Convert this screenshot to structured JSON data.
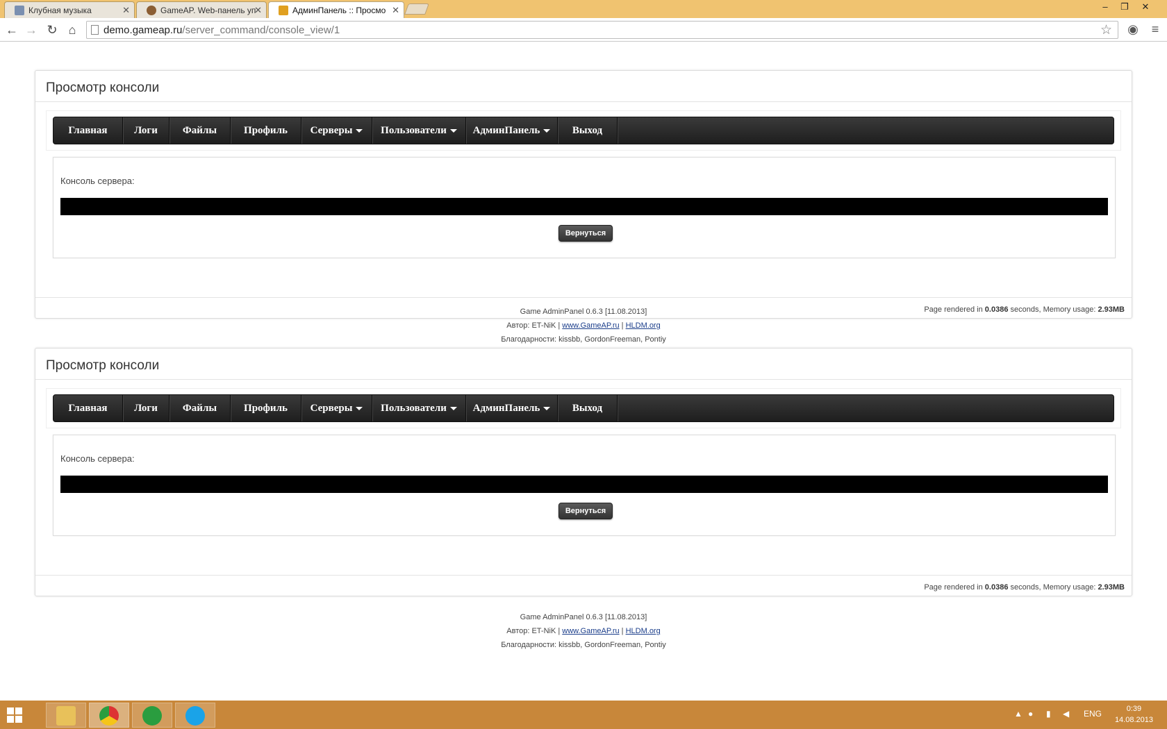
{
  "browser": {
    "tabs": [
      {
        "title": "Клубная музыка",
        "active": false
      },
      {
        "title": "GameAP. Web-панель уп",
        "active": false
      },
      {
        "title": "АдминПанель :: Просмо",
        "active": true
      }
    ],
    "url_host": "demo.gameap.ru",
    "url_path": "/server_command/console_view/1"
  },
  "page": {
    "sections": [
      {
        "title": "Просмотр консоли",
        "menu": [
          "Главная",
          "Логи",
          "Файлы",
          "Профиль",
          "Серверы",
          "Пользователи",
          "АдминПанель",
          "Выход"
        ],
        "console_label": "Консоль сервера:",
        "back_button": "Вернуться",
        "render_prefix": "Page rendered in ",
        "render_seconds": "0.0386",
        "render_mid": " seconds, Memory usage: ",
        "render_memory": "2.93MB",
        "footer_version": "Game AdminPanel 0.6.3 [11.08.2013]",
        "footer_author_prefix": "Автор: ET-NiK | ",
        "footer_link1": "www.GameAP.ru",
        "footer_sep": " | ",
        "footer_link2": "HLDM.org",
        "footer_thanks": "Благодарности: kissbb, GordonFreeman, Pontiy"
      },
      {
        "title": "Просмотр консоли",
        "menu": [
          "Главная",
          "Логи",
          "Файлы",
          "Профиль",
          "Серверы",
          "Пользователи",
          "АдминПанель",
          "Выход"
        ],
        "console_label": "Консоль сервера:",
        "back_button": "Вернуться",
        "render_prefix": "Page rendered in ",
        "render_seconds": "0.0386",
        "render_mid": " seconds, Memory usage: ",
        "render_memory": "2.93MB",
        "footer_version": "Game AdminPanel 0.6.3 [11.08.2013]",
        "footer_author_prefix": "Автор: ET-NiK | ",
        "footer_link1": "www.GameAP.ru",
        "footer_sep": " | ",
        "footer_link2": "HLDM.org",
        "footer_thanks": "Благодарности: kissbb, GordonFreeman, Pontiy"
      }
    ]
  },
  "taskbar": {
    "apps": [
      "file-explorer-icon",
      "chrome-icon",
      "utorrent-icon",
      "skype-icon"
    ],
    "language": "ENG",
    "time": "0:39",
    "date": "14.08.2013"
  },
  "colors": {
    "titlebar": "#f0c370",
    "taskbar": "#c8873a",
    "menubar": "#2a2a2a",
    "console": "#000000"
  }
}
